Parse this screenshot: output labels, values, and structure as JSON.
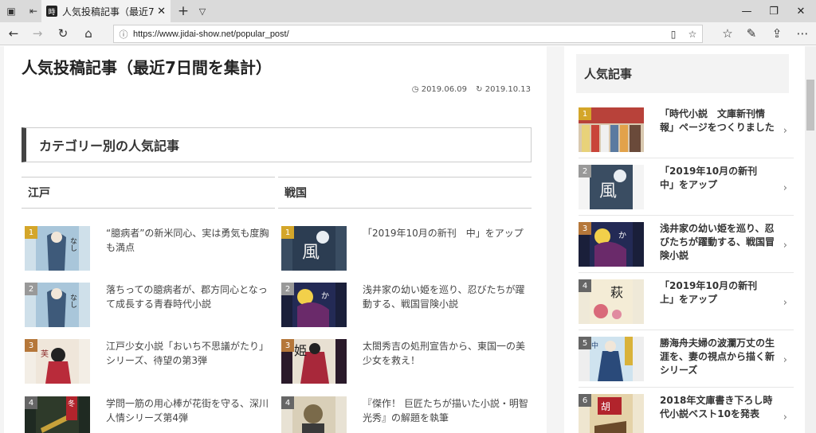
{
  "browser": {
    "tab_title": "人気投稿記事（最近7日",
    "url": "https://www.jidai-show.net/popular_post/"
  },
  "article": {
    "title": "人気投稿記事（最近7日間を集計）",
    "published": "2019.06.09",
    "updated": "2019.10.13",
    "section_title": "カテゴリー別の人気記事",
    "columns": [
      {
        "heading": "江戸",
        "items": [
          {
            "rank": "1",
            "text": "“臆病者”の新米同心、実は勇気も度胸も満点",
            "rank_color": "#d4a62a"
          },
          {
            "rank": "2",
            "text": "落ちっての臆病者が、郡方同心となって成長する青春時代小説",
            "rank_color": "#999999"
          },
          {
            "rank": "3",
            "text": "江戸少女小説「おいち不思議がたり」シリーズ、待望の第3弾",
            "rank_color": "#b5773a"
          },
          {
            "rank": "4",
            "text": "学問一筋の用心棒が花街を守る、深川人情シリーズ第4弾",
            "rank_color": "#666666"
          }
        ]
      },
      {
        "heading": "戦国",
        "items": [
          {
            "rank": "1",
            "text": "「2019年10月の新刊　中」をアップ",
            "rank_color": "#d4a62a"
          },
          {
            "rank": "2",
            "text": "浅井家の幼い姫を巡り、忍びたちが躍動する、戦国冒険小説",
            "rank_color": "#999999"
          },
          {
            "rank": "3",
            "text": "太閤秀吉の処刑宣告から、東国一の美少女を救え！",
            "rank_color": "#b5773a"
          },
          {
            "rank": "4",
            "text": "『傑作！ 巨匠たちが描いた小説・明智光秀』の解題を執筆",
            "rank_color": "#666666"
          }
        ]
      }
    ]
  },
  "sidebar": {
    "heading": "人気記事",
    "items": [
      {
        "rank": "1",
        "text": "「時代小説　文庫新刊情報」ページをつくりました",
        "rank_color": "#d4a62a"
      },
      {
        "rank": "2",
        "text": "「2019年10月の新刊　中」をアップ",
        "rank_color": "#999999"
      },
      {
        "rank": "3",
        "text": "浅井家の幼い姫を巡り、忍びたちが躍動する、戦国冒険小説",
        "rank_color": "#b5773a"
      },
      {
        "rank": "4",
        "text": "「2019年10月の新刊　上」をアップ",
        "rank_color": "#666666"
      },
      {
        "rank": "5",
        "text": "勝海舟夫婦の波瀾万丈の生涯を、妻の視点から描く新シリーズ",
        "rank_color": "#666666"
      },
      {
        "rank": "6",
        "text": "2018年文庫書き下ろし時代小説ベスト10を発表",
        "rank_color": "#666666"
      }
    ]
  },
  "covers": {
    "edo1": "なし\n左事件簿",
    "edo2": "なし\n左事件簿",
    "edo3": "ち\n芙く",
    "edo4": "冬木川",
    "sen1": "風",
    "sen2": "かゆく",
    "sen3": "姫",
    "side4": "萩の\n散る",
    "side5": "胡",
    "side6": "胡蝶"
  }
}
